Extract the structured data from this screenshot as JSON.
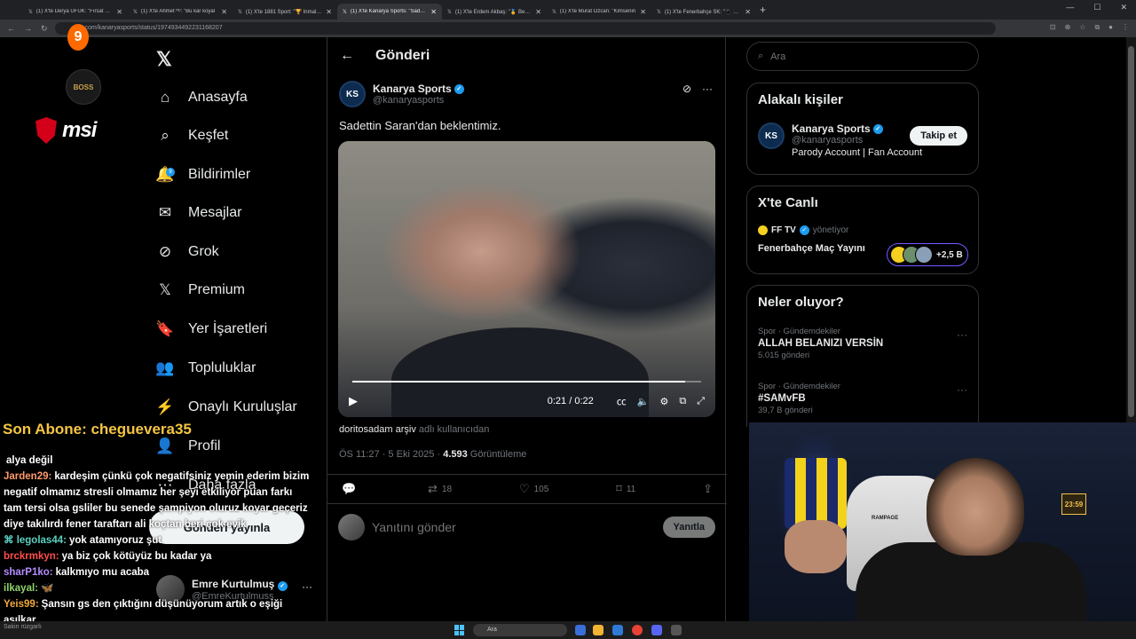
{
  "browser": {
    "tabs": [
      {
        "label": "(1) X'te Derya UFUK: \"Fırsat biteve",
        "active": false
      },
      {
        "label": "(1) X'te Ahmet ᴴᴰ: \"Bu kar koyal",
        "active": false
      },
      {
        "label": "(1) X'te 1881 Sport: \"🏆 Inmalyın",
        "active": false
      },
      {
        "label": "(1) X'te Kanarya Sports: \"Sadettin",
        "active": true
      },
      {
        "label": "(1) X'te Erdem Akbaş: \"🏅 Beşikt",
        "active": false
      },
      {
        "label": "(1) X'te Murat Özcan: \"Kimsenin",
        "active": false
      },
      {
        "label": "(1) X'te Fenerbahçe SK: \"📱 Son",
        "active": false
      }
    ],
    "new_tab": "+",
    "url": "x.com/kanaryasports/status/1974934492231168207"
  },
  "nav": {
    "items": [
      {
        "label": "Anasayfa",
        "icon": "home-icon"
      },
      {
        "label": "Keşfet",
        "icon": "search-icon"
      },
      {
        "label": "Bildirimler",
        "icon": "bell-icon",
        "badge": "9"
      },
      {
        "label": "Mesajlar",
        "icon": "mail-icon"
      },
      {
        "label": "Grok",
        "icon": "grok-icon"
      },
      {
        "label": "Premium",
        "icon": "x-premium-icon"
      },
      {
        "label": "Yer İşaretleri",
        "icon": "bookmark-icon"
      },
      {
        "label": "Topluluklar",
        "icon": "communities-icon"
      },
      {
        "label": "Onaylı Kuruluşlar",
        "icon": "lightning-icon"
      },
      {
        "label": "Profil",
        "icon": "profile-icon"
      },
      {
        "label": "Daha fazla",
        "icon": "more-icon"
      }
    ],
    "post_button": "Gönderi yayınla",
    "account": {
      "name": "Emre Kurtulmuş",
      "handle": "@EmreKurtulmuss"
    }
  },
  "overlay": {
    "boss_badge": "BOSS",
    "msi": "msi",
    "sub_banner": "Son Abone: cheguevera35",
    "chat": [
      {
        "user": "",
        "text": "alya değil",
        "color": "#ffffff"
      },
      {
        "user": "Jarden29:",
        "text": "kardeşim çünkü çok negatifsiniz yemin ederim bizim negatif olmamız stresli olmamız her şeyi etkiliyor puan farkı tam tersi olsa gsliler bu senede şampiyon oluruz koyar geçeriz diye takılırdı fener taraftarı ali koçtan beri çok evik",
        "color": "#ff9b6b"
      },
      {
        "user": "⌘ legolas44:",
        "text": "yok atamıyoruz şut",
        "color": "#5ad1c3"
      },
      {
        "user": "brckrmkyn:",
        "text": "ya biz çok kötüyüz bu kadar ya",
        "color": "#ff4d4d"
      },
      {
        "user": "sharP1ko:",
        "text": "kalkmıyo mu acaba",
        "color": "#b48cff"
      },
      {
        "user": "ilkayal:",
        "text": "🦋",
        "color": "#8fd36b"
      },
      {
        "user": "Yeis99:",
        "text": "Şansın gs den çıktığını düşünüyorum artık o eşiği aşılkar",
        "color": "#f2a93b"
      }
    ],
    "webcam_clock": "23:59",
    "chair_brand": "RAMPAGE"
  },
  "tweet": {
    "header_title": "Gönderi",
    "author_name": "Kanarya Sports",
    "author_handle": "@kanaryasports",
    "avatar_text": "KS",
    "text": "Sadettin Saran'dan beklentimiz.",
    "video": {
      "time": "0:21 / 0:22",
      "progress": 0.955
    },
    "attribution_user": "doritosadam arşiv",
    "attribution_suffix": "adlı kullanıcıdan",
    "time": "ÖS 11:27 · 5 Eki 2025 ·",
    "views_count": "4.593",
    "views_label": "Görüntüleme",
    "metrics": {
      "replies": "",
      "retweets": "18",
      "likes": "105",
      "bookmarks": "11"
    },
    "reply_placeholder": "Yanıtını gönder",
    "reply_button": "Yanıtla"
  },
  "right": {
    "search_placeholder": "Ara",
    "relevant": {
      "title": "Alakalı kişiler",
      "name": "Kanarya Sports",
      "handle": "@kanaryasports",
      "bio": "Parody Account | Fan Account",
      "follow": "Takip et"
    },
    "live": {
      "title": "X'te Canlı",
      "host": "FF TV",
      "host_role": "yönetiyor",
      "event": "Fenerbahçe Maç Yayını",
      "count": "+2,5 B"
    },
    "trends": {
      "title": "Neler oluyor?",
      "items": [
        {
          "category": "Spor · Gündemdekiler",
          "name": "ALLAH BELANIZI VERSİN",
          "count": "5.015 gönderi"
        },
        {
          "category": "Spor · Gündemdekiler",
          "name": "#SAMvFB",
          "count": "39,7 B gönderi"
        }
      ]
    }
  },
  "taskbar": {
    "search": "Ara",
    "left_text": "Sakin rüzgarlı"
  },
  "colors": {
    "verified": "#1d9bf0",
    "accent": "#1d9bf0",
    "live_border": "#7856ff",
    "banner": "#f5c542"
  }
}
